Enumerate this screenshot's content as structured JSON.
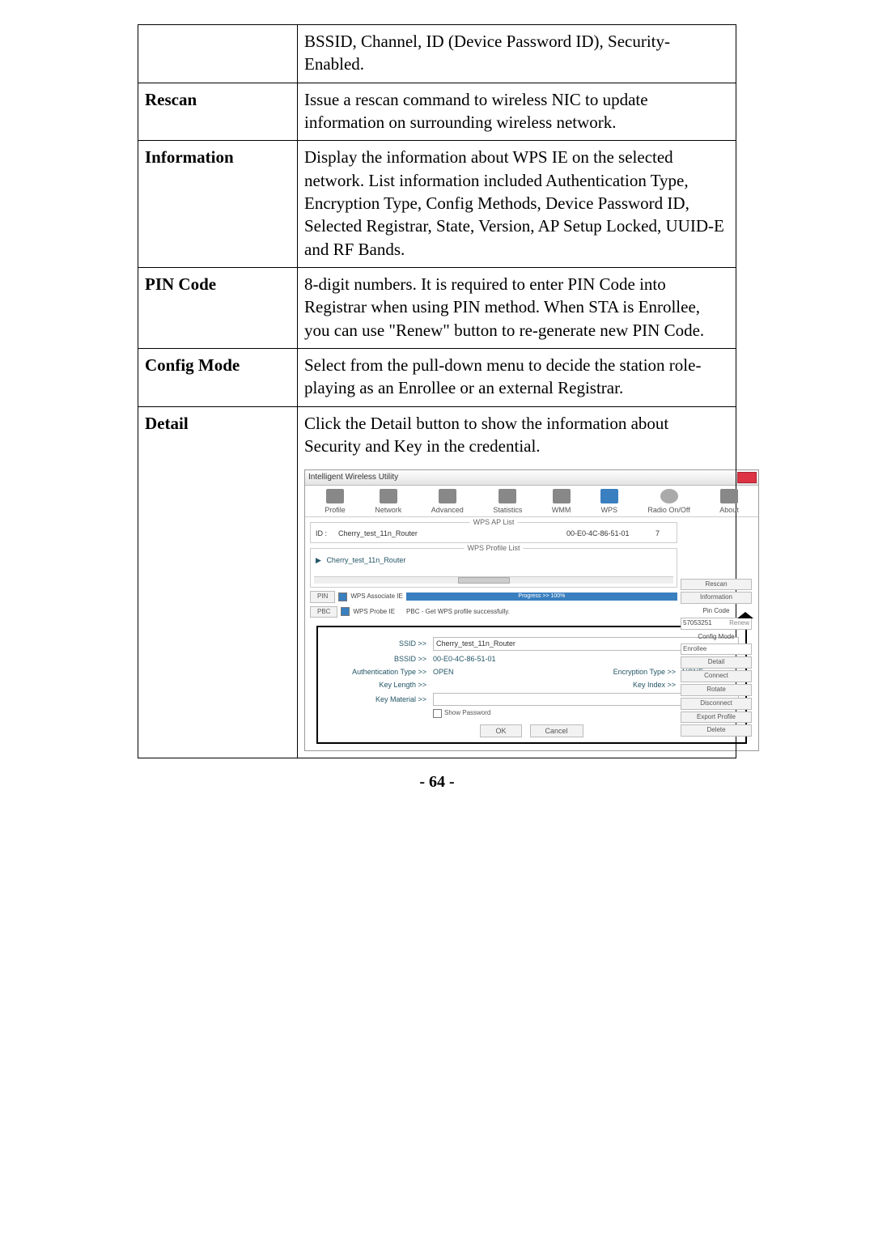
{
  "row_top": "BSSID, Channel, ID (Device Password ID), Security-Enabled.",
  "rescan_label": "Rescan",
  "rescan_text": "Issue a rescan command to wireless NIC to update information on surrounding wireless network.",
  "information_label": "Information",
  "information_text": "Display the information about WPS IE on the selected network. List information included Authentication Type, Encryption Type, Config Methods, Device Password ID, Selected Registrar, State, Version, AP Setup Locked, UUID-E and RF Bands.",
  "pin_label": "PIN Code",
  "pin_text": "8-digit numbers. It is required to enter PIN Code into Registrar when using PIN method. When STA is Enrollee, you can use \"Renew\" button to re-generate new PIN Code.",
  "config_label": "Config Mode",
  "config_text": "Select from the pull-down menu to decide the station role-playing as an Enrollee or an external Registrar.",
  "detail_label": "Detail",
  "detail_text": "Click the Detail button to show the information about Security and Key in the credential.",
  "page_number": "- 64 -",
  "shot": {
    "title": "Intelligent Wireless Utility",
    "tabs": {
      "profile": "Profile",
      "network": "Network",
      "advanced": "Advanced",
      "statistics": "Statistics",
      "wmm": "WMM",
      "wps": "WPS",
      "radio": "Radio On/Off",
      "about": "About"
    },
    "group_ap": "WPS AP List",
    "group_prof": "WPS Profile List",
    "ap_row": {
      "idcol": "ID :",
      "ssid": "Cherry_test_11n_Router",
      "bssid": "00-E0-4C-86-51-01",
      "ch": "7"
    },
    "side": {
      "rescan": "Rescan",
      "information": "Information",
      "pin_code_label": "Pin Code",
      "pin_code_value": "57053251",
      "renew": "Renew",
      "config_mode_label": "Config Mode",
      "config_mode_value": "Enrollee",
      "detail": "Detail",
      "connect": "Connect",
      "rotate": "Rotate",
      "disconnect": "Disconnect",
      "export": "Export Profile",
      "delete": "Delete"
    },
    "profile_item": "Cherry_test_11n_Router",
    "buttons": {
      "pin": "PIN",
      "pbc": "PBC",
      "assoc_ie": "WPS Associate IE",
      "probe_ie": "WPS Probe IE"
    },
    "progress": "Progress >> 100%",
    "status": "PBC - Get WPS profile successfully.",
    "panel": {
      "ssid_label": "SSID >>",
      "ssid_value": "Cherry_test_11n_Router",
      "bssid_label": "BSSID >>",
      "bssid_value": "00-E0-4C-86-51-01",
      "auth_label": "Authentication Type >>",
      "auth_value": "OPEN",
      "enc_label": "Encryption Type >>",
      "enc_value": "NONE",
      "keylen_label": "Key Length >>",
      "keyidx_label": "Key Index >>",
      "keymat_label": "Key Material >>",
      "show_pw": "Show Password",
      "ok": "OK",
      "cancel": "Cancel"
    }
  }
}
